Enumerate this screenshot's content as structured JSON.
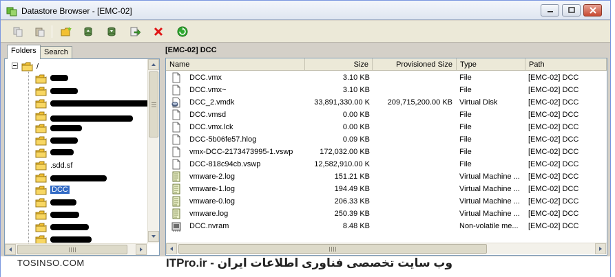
{
  "window": {
    "title": "Datastore Browser - [EMC-02]",
    "controls": [
      "minimize-icon",
      "maximize-icon",
      "close-icon"
    ]
  },
  "toolbar": {
    "buttons": [
      {
        "name": "copy-button",
        "icon": "copy-icon"
      },
      {
        "name": "paste-button",
        "icon": "paste-icon"
      },
      {
        "name": "new-folder-button",
        "icon": "new-folder-icon"
      },
      {
        "name": "upload-button",
        "icon": "upload-icon"
      },
      {
        "name": "download-button",
        "icon": "download-icon"
      },
      {
        "name": "register-vm-button",
        "icon": "register-vm-icon"
      },
      {
        "name": "delete-button",
        "icon": "delete-icon"
      },
      {
        "name": "refresh-button",
        "icon": "refresh-icon"
      }
    ],
    "colors": {
      "folder": "#f2c033",
      "delete": "#e01616",
      "refresh": "#2ea82e"
    }
  },
  "left_pane": {
    "tabs": [
      {
        "label": "Folders",
        "active": true
      },
      {
        "label": "Search",
        "active": false
      }
    ],
    "tree": {
      "root": "/",
      "items": [
        {
          "label": "",
          "redacted": true
        },
        {
          "label": "",
          "redacted": true
        },
        {
          "label": "",
          "redacted": true
        },
        {
          "label": "",
          "redacted": true
        },
        {
          "label": "",
          "redacted": true
        },
        {
          "label": "",
          "redacted": true
        },
        {
          "label": "",
          "redacted": true
        },
        {
          "label": ".sdd.sf",
          "redacted": false
        },
        {
          "label": "",
          "redacted": true
        },
        {
          "label": "DCC",
          "redacted": false,
          "selected": true
        },
        {
          "label": "",
          "redacted": true
        },
        {
          "label": "",
          "redacted": true
        },
        {
          "label": "",
          "redacted": true
        },
        {
          "label": "",
          "redacted": true
        },
        {
          "label": "",
          "redacted": true
        },
        {
          "label": "",
          "redacted": true
        }
      ]
    },
    "selection_color": "#316ac5"
  },
  "right_pane": {
    "path_label": "[EMC-02] DCC",
    "columns": [
      "Name",
      "Size",
      "Provisioned Size",
      "Type",
      "Path"
    ],
    "rows": [
      {
        "icon": "file-icon",
        "name": "DCC.vmx",
        "size": "3.10 KB",
        "provisioned": "",
        "type": "File",
        "path": "[EMC-02] DCC"
      },
      {
        "icon": "file-icon",
        "name": "DCC.vmx~",
        "size": "3.10 KB",
        "provisioned": "",
        "type": "File",
        "path": "[EMC-02] DCC"
      },
      {
        "icon": "virtual-disk-icon",
        "name": "DCC_2.vmdk",
        "size": "33,891,330.00 K",
        "provisioned": "209,715,200.00 KB",
        "type": "Virtual Disk",
        "path": "[EMC-02] DCC"
      },
      {
        "icon": "file-icon",
        "name": "DCC.vmsd",
        "size": "0.00 KB",
        "provisioned": "",
        "type": "File",
        "path": "[EMC-02] DCC"
      },
      {
        "icon": "file-icon",
        "name": "DCC.vmx.lck",
        "size": "0.00 KB",
        "provisioned": "",
        "type": "File",
        "path": "[EMC-02] DCC"
      },
      {
        "icon": "file-icon",
        "name": "DCC-5b06fe57.hlog",
        "size": "0.09 KB",
        "provisioned": "",
        "type": "File",
        "path": "[EMC-02] DCC"
      },
      {
        "icon": "file-icon",
        "name": "vmx-DCC-2173473995-1.vswp",
        "size": "172,032.00 KB",
        "provisioned": "",
        "type": "File",
        "path": "[EMC-02] DCC"
      },
      {
        "icon": "file-icon",
        "name": "DCC-818c94cb.vswp",
        "size": "12,582,910.00 K",
        "provisioned": "",
        "type": "File",
        "path": "[EMC-02] DCC"
      },
      {
        "icon": "log-icon",
        "name": "vmware-2.log",
        "size": "151.21 KB",
        "provisioned": "",
        "type": "Virtual Machine ...",
        "path": "[EMC-02] DCC"
      },
      {
        "icon": "log-icon",
        "name": "vmware-1.log",
        "size": "194.49 KB",
        "provisioned": "",
        "type": "Virtual Machine ...",
        "path": "[EMC-02] DCC"
      },
      {
        "icon": "log-icon",
        "name": "vmware-0.log",
        "size": "206.33 KB",
        "provisioned": "",
        "type": "Virtual Machine ...",
        "path": "[EMC-02] DCC"
      },
      {
        "icon": "log-icon",
        "name": "vmware.log",
        "size": "250.39 KB",
        "provisioned": "",
        "type": "Virtual Machine ...",
        "path": "[EMC-02] DCC"
      },
      {
        "icon": "nvram-icon",
        "name": "DCC.nvram",
        "size": "8.48 KB",
        "provisioned": "",
        "type": "Non-volatile me...",
        "path": "[EMC-02] DCC"
      }
    ]
  },
  "footer": {
    "left_brand": "TOSINSO.COM",
    "right_brand": "ITPro.ir - وب سایت تخصصی فناوری اطلاعات ایران"
  }
}
